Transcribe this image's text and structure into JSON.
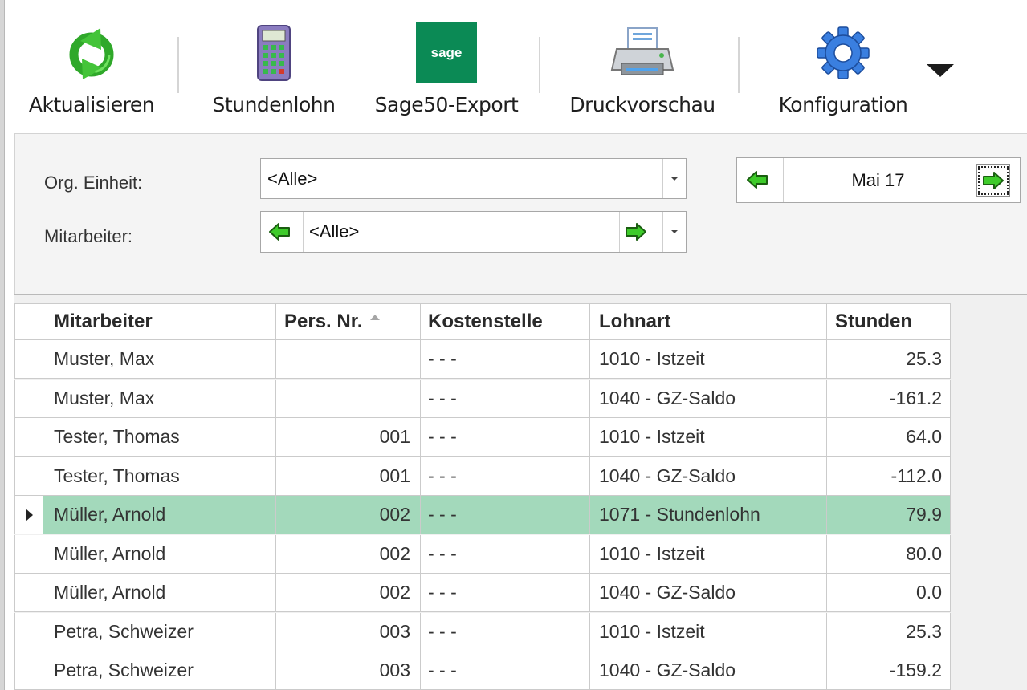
{
  "toolbar": {
    "items": [
      {
        "label": "Aktualisieren",
        "icon": "refresh-icon"
      },
      {
        "label": "Stundenlohn",
        "icon": "calculator-icon"
      },
      {
        "label": "Sage50-Export",
        "icon": "sage-logo-icon",
        "logo_text": "sage"
      },
      {
        "label": "Druckvorschau",
        "icon": "printer-icon"
      },
      {
        "label": "Konfiguration",
        "icon": "gear-icon"
      }
    ]
  },
  "filter": {
    "org_label": "Org. Einheit:",
    "org_value": "<Alle>",
    "employee_label": "Mitarbeiter:",
    "employee_value": "<Alle>",
    "period_value": "Mai 17"
  },
  "grid": {
    "columns": [
      "Mitarbeiter",
      "Pers. Nr.",
      "Kostenstelle",
      "Lohnart",
      "Stunden"
    ],
    "sort_column": "Pers. Nr.",
    "selected_row_index": 4,
    "rows": [
      {
        "name": "Muster, Max",
        "pers": "",
        "kost": "- - -",
        "lohn": "1010 - Istzeit",
        "std": "25.3"
      },
      {
        "name": "Muster, Max",
        "pers": "",
        "kost": "- - -",
        "lohn": "1040 - GZ-Saldo",
        "std": "-161.2"
      },
      {
        "name": "Tester, Thomas",
        "pers": "001",
        "kost": "- - -",
        "lohn": "1010 - Istzeit",
        "std": "64.0"
      },
      {
        "name": "Tester, Thomas",
        "pers": "001",
        "kost": "- - -",
        "lohn": "1040 - GZ-Saldo",
        "std": "-112.0"
      },
      {
        "name": "Müller, Arnold",
        "pers": "002",
        "kost": "- - -",
        "lohn": "1071 - Stundenlohn",
        "std": "79.9"
      },
      {
        "name": "Müller, Arnold",
        "pers": "002",
        "kost": "- - -",
        "lohn": "1010 - Istzeit",
        "std": "80.0"
      },
      {
        "name": "Müller, Arnold",
        "pers": "002",
        "kost": "- - -",
        "lohn": "1040 - GZ-Saldo",
        "std": "0.0"
      },
      {
        "name": "Petra, Schweizer",
        "pers": "003",
        "kost": "- - -",
        "lohn": "1010 - Istzeit",
        "std": "25.3"
      },
      {
        "name": "Petra, Schweizer",
        "pers": "003",
        "kost": "- - -",
        "lohn": "1040 - GZ-Saldo",
        "std": "-159.2"
      }
    ]
  },
  "colors": {
    "selected_row": "#a3d9bb",
    "sage_brand": "#0b8a55",
    "nav_arrow": "#3ecb2a"
  }
}
